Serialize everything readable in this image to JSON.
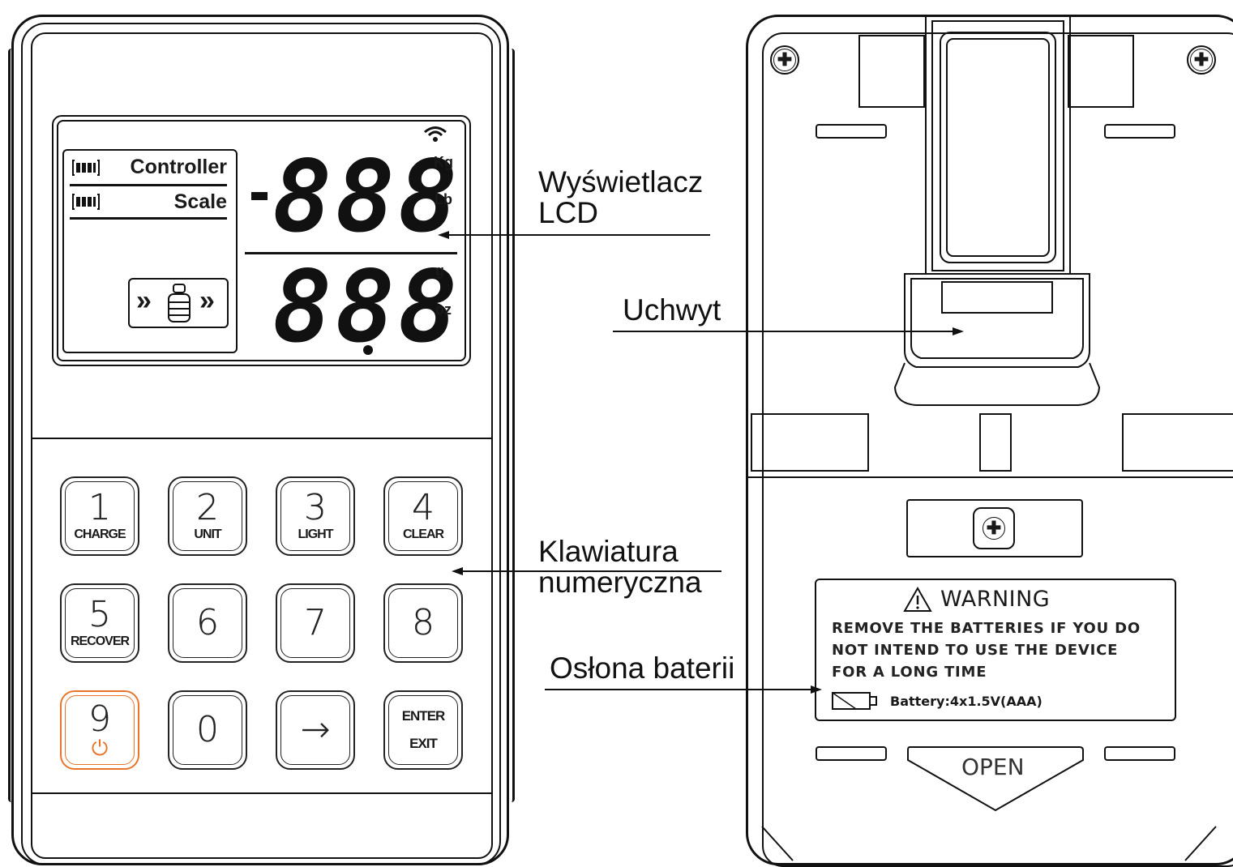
{
  "lcd": {
    "status": {
      "controller_label": "Controller",
      "scale_label": "Scale"
    },
    "upper_digits": "888",
    "lower_digits": "888",
    "units": {
      "kg": "Kg",
      "lb": "Lb",
      "g": "g",
      "oz": "oz"
    }
  },
  "keypad": {
    "keys": [
      {
        "num": "1",
        "sub": "CHARGE"
      },
      {
        "num": "2",
        "sub": "UNIT"
      },
      {
        "num": "3",
        "sub": "LIGHT"
      },
      {
        "num": "4",
        "sub": "CLEAR"
      },
      {
        "num": "5",
        "sub": "RECOVER"
      },
      {
        "num": "6",
        "sub": ""
      },
      {
        "num": "7",
        "sub": ""
      },
      {
        "num": "8",
        "sub": ""
      },
      {
        "num": "9",
        "sub": ""
      },
      {
        "num": "0",
        "sub": ""
      },
      {
        "num": "→",
        "sub": ""
      },
      {
        "num": "",
        "sub": "ENTER",
        "sub2": "EXIT"
      }
    ]
  },
  "callouts": {
    "lcd_line1": "Wyświetlacz",
    "lcd_line2": "LCD",
    "holder": "Uchwyt",
    "keypad_line1": "Klawiatura",
    "keypad_line2": "numeryczna",
    "battery_cover": "Osłona baterii"
  },
  "back": {
    "warning_title": "WARNING",
    "warning_lines": [
      "REMOVE  THE  BATTERIES  IF  YOU  DO",
      "NOT  INTEND  TO  USE  THE  DEVICE",
      "FOR  A  LONG  TIME"
    ],
    "battery_spec": "Battery:4x1.5V(AAA)",
    "open_label": "OPEN"
  },
  "colors": {
    "power_key_accent": "#e8752a",
    "line": "#111111"
  }
}
